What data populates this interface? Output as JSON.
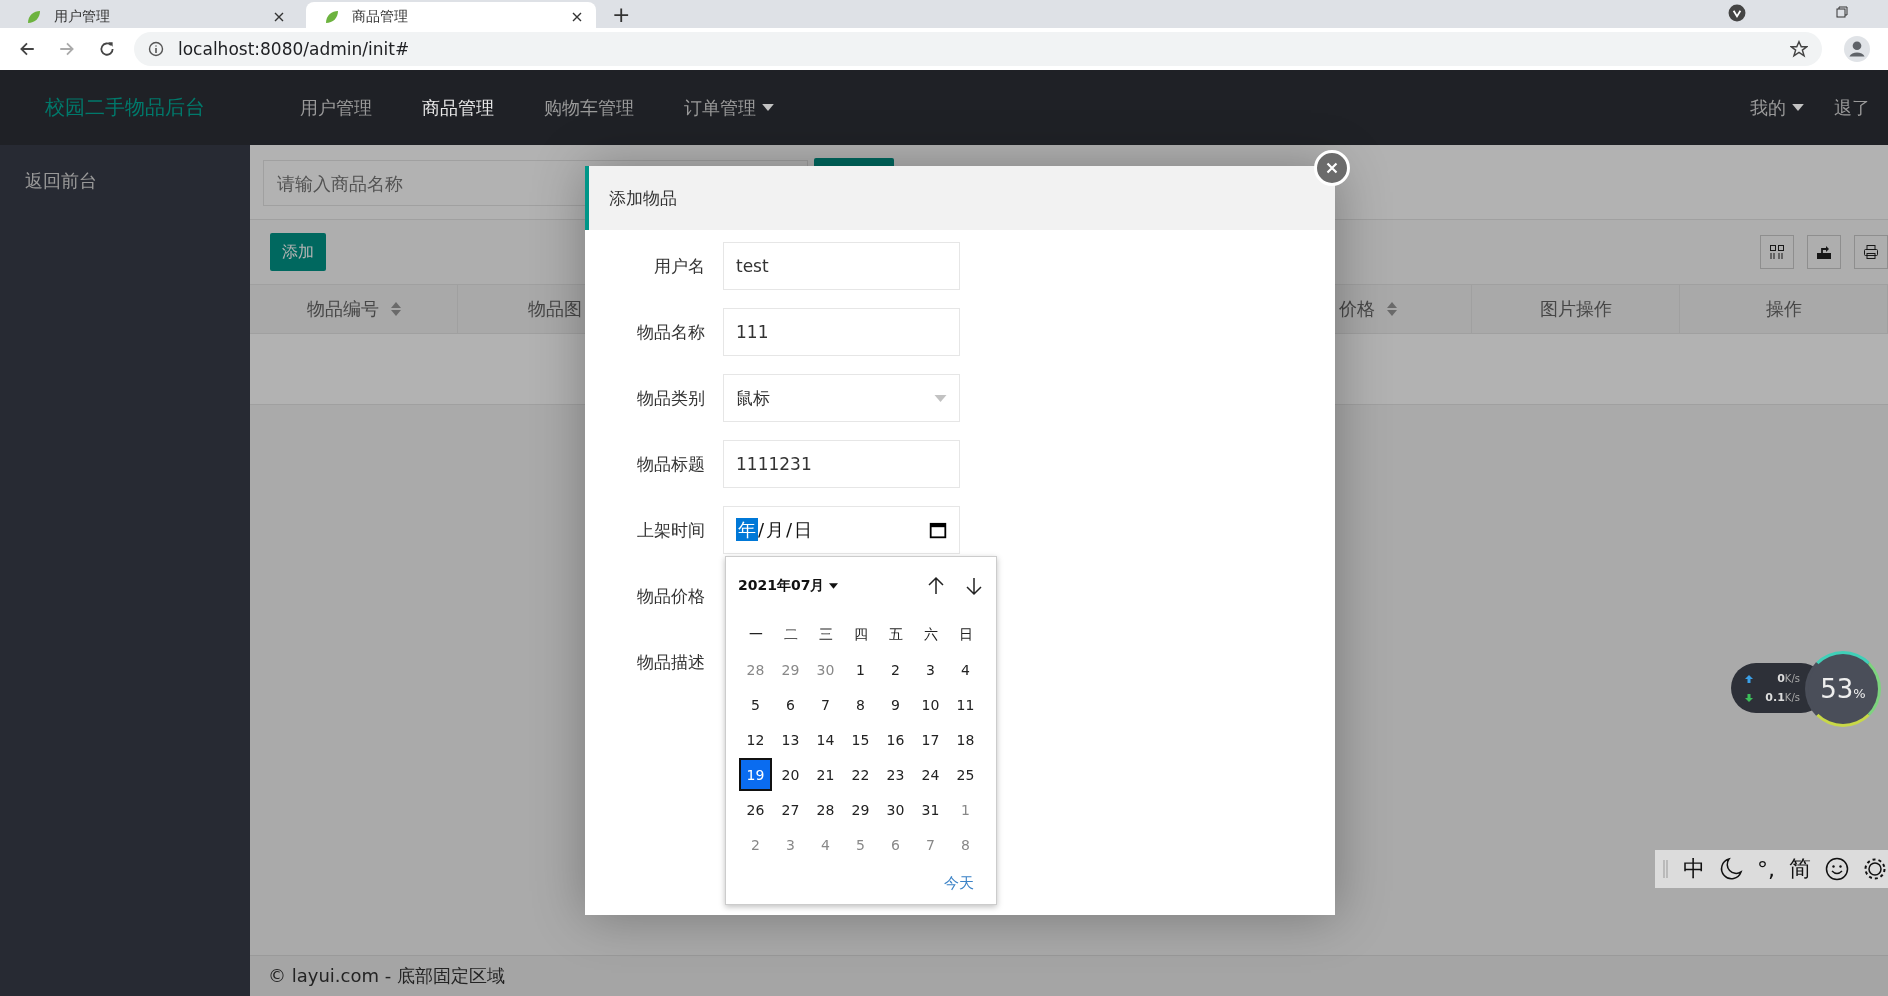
{
  "browser": {
    "tabs": [
      {
        "title": "用户管理",
        "selected": false
      },
      {
        "title": "商品管理",
        "selected": true
      }
    ],
    "new_tab": "+",
    "url": "localhost:8080/admin/init#"
  },
  "header": {
    "logo": "校园二手物品后台",
    "nav": [
      {
        "label": "用户管理",
        "active": false,
        "dropdown": false
      },
      {
        "label": "商品管理",
        "active": true,
        "dropdown": false
      },
      {
        "label": "购物车管理",
        "active": false,
        "dropdown": false
      },
      {
        "label": "订单管理",
        "active": false,
        "dropdown": true
      }
    ],
    "user_menu": "我的",
    "logout": "退了"
  },
  "sidebar": {
    "items": [
      {
        "label": "返回前台"
      }
    ]
  },
  "page": {
    "search": {
      "placeholder": "请输入商品名称"
    },
    "add_button": "添加",
    "table": {
      "columns": [
        {
          "label": "物品编号",
          "sortable": true
        },
        {
          "label": "物品图"
        },
        {
          "label": "价格",
          "sortable": true
        },
        {
          "label": "图片操作",
          "sortable": false
        },
        {
          "label": "操作",
          "sortable": false
        }
      ]
    },
    "footer": "© layui.com - 底部固定区域"
  },
  "dialog": {
    "title": "添加物品",
    "fields": [
      {
        "label": "用户名",
        "kind": "text",
        "value": "test"
      },
      {
        "label": "物品名称",
        "kind": "text",
        "value": "111"
      },
      {
        "label": "物品类别",
        "kind": "select",
        "value": "鼠标"
      },
      {
        "label": "物品标题",
        "kind": "text",
        "value": "1111231"
      },
      {
        "label": "上架时间",
        "kind": "date",
        "separator": "/",
        "segments": [
          {
            "text": "年",
            "selected": true
          },
          {
            "text": "月",
            "selected": false
          },
          {
            "text": "日",
            "selected": false
          }
        ]
      },
      {
        "label": "物品价格",
        "kind": "covered"
      },
      {
        "label": "物品描述",
        "kind": "covered"
      }
    ]
  },
  "calendar": {
    "month": "2021年07月",
    "weekdays": [
      "一",
      "二",
      "三",
      "四",
      "五",
      "六",
      "日"
    ],
    "days": [
      {
        "label": "28",
        "other_month": true,
        "selected": false
      },
      {
        "label": "29",
        "other_month": true,
        "selected": false
      },
      {
        "label": "30",
        "other_month": true,
        "selected": false
      },
      {
        "label": "1",
        "other_month": false,
        "selected": false
      },
      {
        "label": "2",
        "other_month": false,
        "selected": false
      },
      {
        "label": "3",
        "other_month": false,
        "selected": false
      },
      {
        "label": "4",
        "other_month": false,
        "selected": false
      },
      {
        "label": "5",
        "other_month": false,
        "selected": false
      },
      {
        "label": "6",
        "other_month": false,
        "selected": false
      },
      {
        "label": "7",
        "other_month": false,
        "selected": false
      },
      {
        "label": "8",
        "other_month": false,
        "selected": false
      },
      {
        "label": "9",
        "other_month": false,
        "selected": false
      },
      {
        "label": "10",
        "other_month": false,
        "selected": false
      },
      {
        "label": "11",
        "other_month": false,
        "selected": false
      },
      {
        "label": "12",
        "other_month": false,
        "selected": false
      },
      {
        "label": "13",
        "other_month": false,
        "selected": false
      },
      {
        "label": "14",
        "other_month": false,
        "selected": false
      },
      {
        "label": "15",
        "other_month": false,
        "selected": false
      },
      {
        "label": "16",
        "other_month": false,
        "selected": false
      },
      {
        "label": "17",
        "other_month": false,
        "selected": false
      },
      {
        "label": "18",
        "other_month": false,
        "selected": false
      },
      {
        "label": "19",
        "other_month": false,
        "selected": true
      },
      {
        "label": "20",
        "other_month": false,
        "selected": false
      },
      {
        "label": "21",
        "other_month": false,
        "selected": false
      },
      {
        "label": "22",
        "other_month": false,
        "selected": false
      },
      {
        "label": "23",
        "other_month": false,
        "selected": false
      },
      {
        "label": "24",
        "other_month": false,
        "selected": false
      },
      {
        "label": "25",
        "other_month": false,
        "selected": false
      },
      {
        "label": "26",
        "other_month": false,
        "selected": false
      },
      {
        "label": "27",
        "other_month": false,
        "selected": false
      },
      {
        "label": "28",
        "other_month": false,
        "selected": false
      },
      {
        "label": "29",
        "other_month": false,
        "selected": false
      },
      {
        "label": "30",
        "other_month": false,
        "selected": false
      },
      {
        "label": "31",
        "other_month": false,
        "selected": false
      },
      {
        "label": "1",
        "other_month": true,
        "selected": false
      },
      {
        "label": "2",
        "other_month": true,
        "selected": false
      },
      {
        "label": "3",
        "other_month": true,
        "selected": false
      },
      {
        "label": "4",
        "other_month": true,
        "selected": false
      },
      {
        "label": "5",
        "other_month": true,
        "selected": false
      },
      {
        "label": "6",
        "other_month": true,
        "selected": false
      },
      {
        "label": "7",
        "other_month": true,
        "selected": false
      },
      {
        "label": "8",
        "other_month": true,
        "selected": false
      }
    ],
    "today": "今天"
  },
  "net_meter": {
    "upload": "0",
    "upload_unit": "K/s",
    "download": "0.1",
    "download_unit": "K/s",
    "percent": "53",
    "percent_unit": "%"
  },
  "ime_bar": {
    "items": [
      {
        "kind": "text",
        "label": "中"
      },
      {
        "kind": "moon"
      },
      {
        "kind": "text",
        "label": "°,"
      },
      {
        "kind": "text",
        "label": "简"
      },
      {
        "kind": "smiley"
      },
      {
        "kind": "gear"
      }
    ]
  }
}
